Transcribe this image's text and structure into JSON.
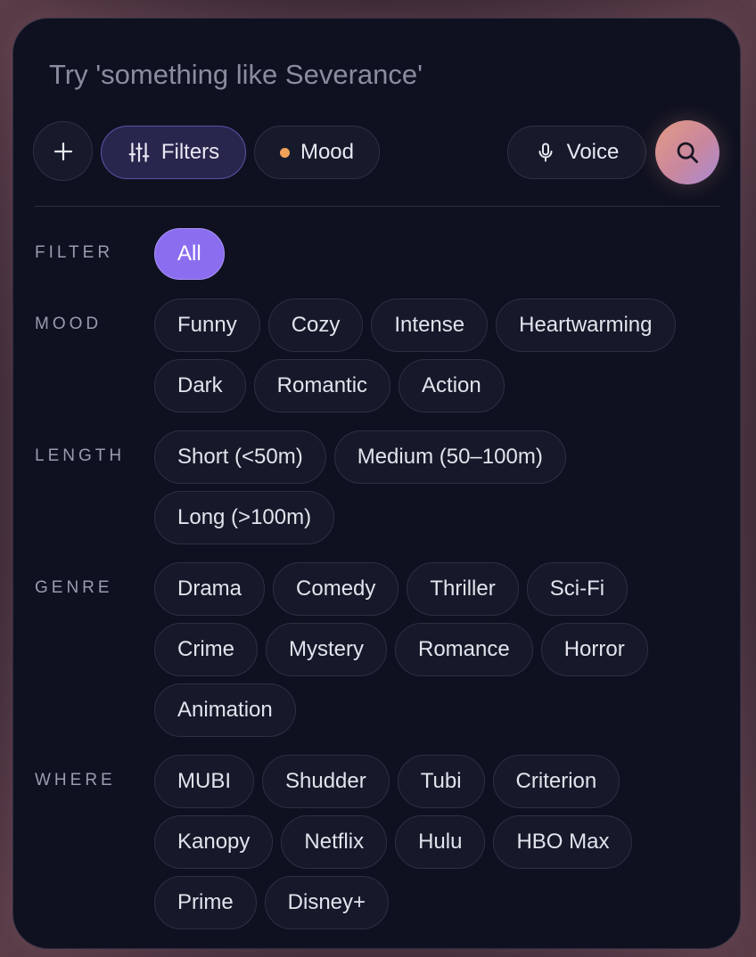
{
  "search": {
    "placeholder": "Try 'something like Severance'"
  },
  "toolbar": {
    "plus_icon": "plus-icon",
    "filters_label": "Filters",
    "mood_label": "Mood",
    "voice_label": "Voice",
    "search_icon": "search-icon"
  },
  "colors": {
    "accent": "#8b6ef0",
    "mood_dot": "#f2a35a",
    "background": "#0f1120"
  },
  "sections": {
    "filter": {
      "label": "FILTER",
      "chips": [
        "All"
      ]
    },
    "mood": {
      "label": "MOOD",
      "chips": [
        "Funny",
        "Cozy",
        "Intense",
        "Heartwarming",
        "Dark",
        "Romantic",
        "Action"
      ]
    },
    "length": {
      "label": "LENGTH",
      "chips": [
        "Short (<50m)",
        "Medium (50–100m)",
        "Long (>100m)"
      ]
    },
    "genre": {
      "label": "GENRE",
      "chips": [
        "Drama",
        "Comedy",
        "Thriller",
        "Sci-Fi",
        "Crime",
        "Mystery",
        "Romance",
        "Horror",
        "Animation"
      ]
    },
    "where": {
      "label": "WHERE",
      "chips": [
        "MUBI",
        "Shudder",
        "Tubi",
        "Criterion",
        "Kanopy",
        "Netflix",
        "Hulu",
        "HBO Max",
        "Prime",
        "Disney+"
      ]
    }
  }
}
